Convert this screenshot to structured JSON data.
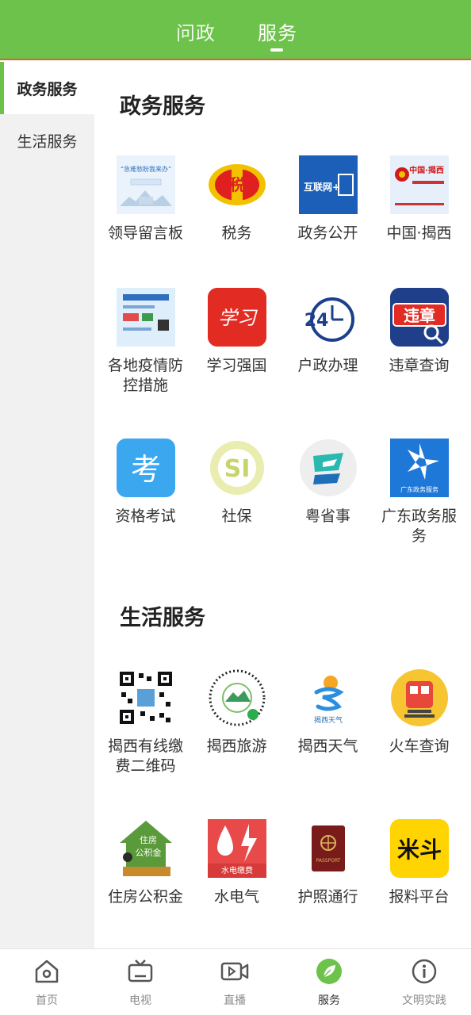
{
  "header": {
    "tabs": [
      {
        "label": "问政"
      },
      {
        "label": "服务"
      }
    ],
    "active_tab": "服务"
  },
  "sidebar": {
    "items": [
      {
        "label": "政务服务"
      },
      {
        "label": "生活服务"
      }
    ],
    "active": "政务服务"
  },
  "sections": [
    {
      "title": "政务服务",
      "items": [
        {
          "label": "领导留言板",
          "icon": "message-board-icon",
          "icon_text": "“急难愁盼我来办”"
        },
        {
          "label": "税务",
          "icon": "tax-emblem-icon",
          "icon_text": "税"
        },
        {
          "label": "政务公开",
          "icon": "internet-gov-icon",
          "icon_text": "互联网+"
        },
        {
          "label": "中国·揭西",
          "icon": "china-jiexi-icon",
          "icon_text": "中国·揭西"
        },
        {
          "label": "各地疫情防控措施",
          "icon": "epidemic-notice-icon",
          "icon_text": ""
        },
        {
          "label": "学习强国",
          "icon": "xuexi-icon",
          "icon_text": "学习"
        },
        {
          "label": "户政办理",
          "icon": "24-hours-icon",
          "icon_text": "24"
        },
        {
          "label": "违章查询",
          "icon": "violation-search-icon",
          "icon_text": "违章"
        },
        {
          "label": "资格考试",
          "icon": "exam-icon",
          "icon_text": "考"
        },
        {
          "label": "社保",
          "icon": "social-security-icon",
          "icon_text": "SI"
        },
        {
          "label": "粤省事",
          "icon": "yueshengshi-icon",
          "icon_text": ""
        },
        {
          "label": "广东政务服务",
          "icon": "guangdong-gov-icon",
          "icon_text": "广东政务服务"
        }
      ]
    },
    {
      "title": "生活服务",
      "items": [
        {
          "label": "揭西有线缴费二维码",
          "icon": "qr-code-icon",
          "icon_text": ""
        },
        {
          "label": "揭西旅游",
          "icon": "tourism-miniprogram-icon",
          "icon_text": ""
        },
        {
          "label": "揭西天气",
          "icon": "weather-icon",
          "icon_text": "揭西天气"
        },
        {
          "label": "火车查询",
          "icon": "train-icon",
          "icon_text": ""
        },
        {
          "label": "住房公积金",
          "icon": "housing-fund-icon",
          "icon_text": "住房公积金"
        },
        {
          "label": "水电气",
          "icon": "utilities-icon",
          "icon_text": "水电缴费"
        },
        {
          "label": "护照通行",
          "icon": "passport-icon",
          "icon_text": "PASSPORT"
        },
        {
          "label": "报料平台",
          "icon": "report-platform-icon",
          "icon_text": "米斗"
        }
      ]
    }
  ],
  "bottom_nav": [
    {
      "label": "首页",
      "icon": "home-icon"
    },
    {
      "label": "电视",
      "icon": "tv-icon"
    },
    {
      "label": "直播",
      "icon": "live-video-icon"
    },
    {
      "label": "服务",
      "icon": "leaf-service-icon"
    },
    {
      "label": "文明实践",
      "icon": "info-icon"
    }
  ],
  "colors": {
    "brand_green": "#6cc24a",
    "header_border": "#e05c3c",
    "sidebar_bg": "#f1f1f1"
  }
}
